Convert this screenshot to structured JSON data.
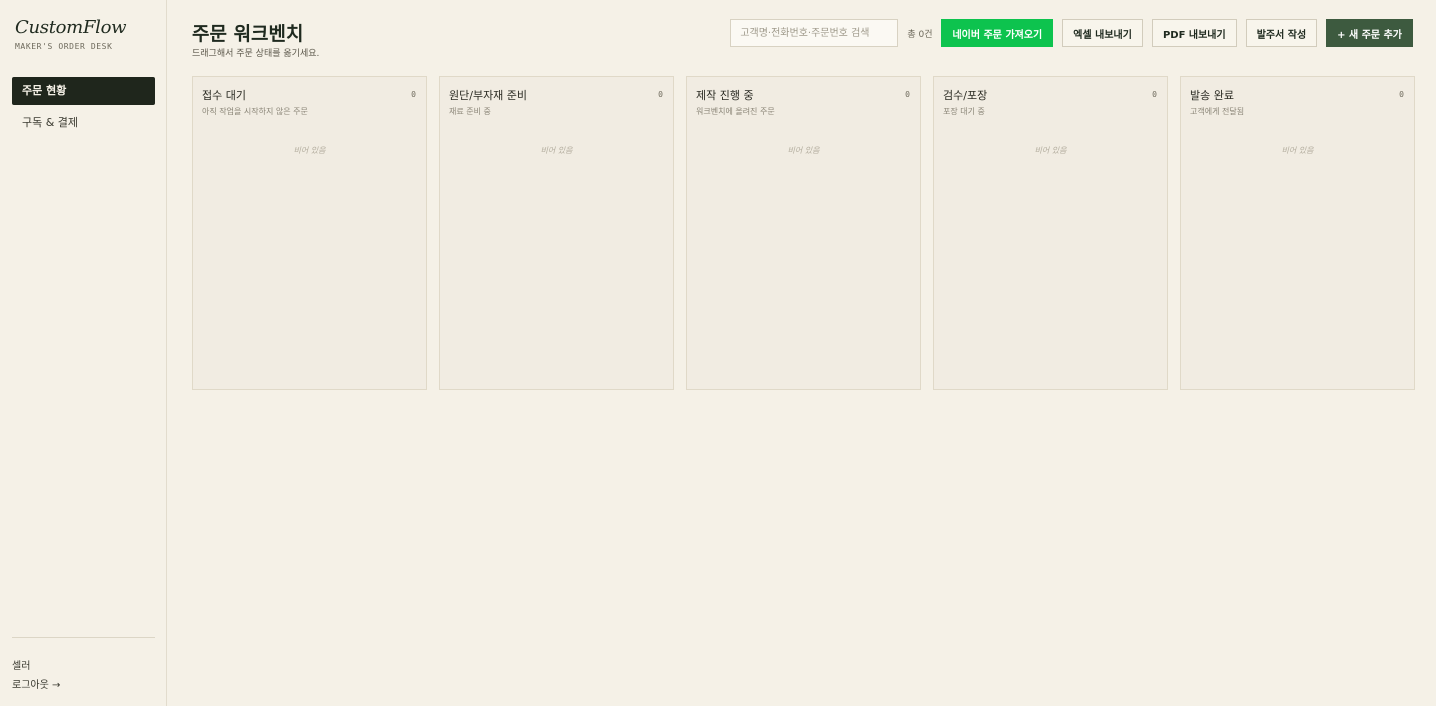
{
  "brand": {
    "name": "CustomFlow",
    "tagline": "MAKER'S ORDER DESK"
  },
  "sidebar": {
    "items": [
      {
        "label": "주문 현황",
        "active": true
      },
      {
        "label": "구독 & 결제",
        "active": false
      }
    ],
    "user": "셀러",
    "logout": "로그아웃 →"
  },
  "header": {
    "title": "주문 워크벤치",
    "subtitle": "드래그해서 주문 상태를 옮기세요."
  },
  "toolbar": {
    "search_placeholder": "고객명·전화번호·주문번호 검색",
    "total": "총 0건",
    "naver_import": "네이버 주문 가져오기",
    "excel_export": "엑셀 내보내기",
    "pdf_export": "PDF 내보내기",
    "purchase_order": "발주서 작성",
    "new_order": "+ 새 주문 추가"
  },
  "board": {
    "empty_label": "비어 있음",
    "columns": [
      {
        "title": "접수 대기",
        "count": "0",
        "desc": "아직 작업을 시작하지 않은 주문"
      },
      {
        "title": "원단/부자재 준비",
        "count": "0",
        "desc": "재료 준비 중"
      },
      {
        "title": "제작 진행 중",
        "count": "0",
        "desc": "워크벤치에 올려진 주문"
      },
      {
        "title": "검수/포장",
        "count": "0",
        "desc": "포장 대기 중"
      },
      {
        "title": "발송 완료",
        "count": "0",
        "desc": "고객에게 전달됨"
      }
    ]
  },
  "colors": {
    "background": "#f5f1e7",
    "active_nav": "#1f261c",
    "naver_green": "#0dc34e",
    "primary": "#3d5a3f"
  }
}
